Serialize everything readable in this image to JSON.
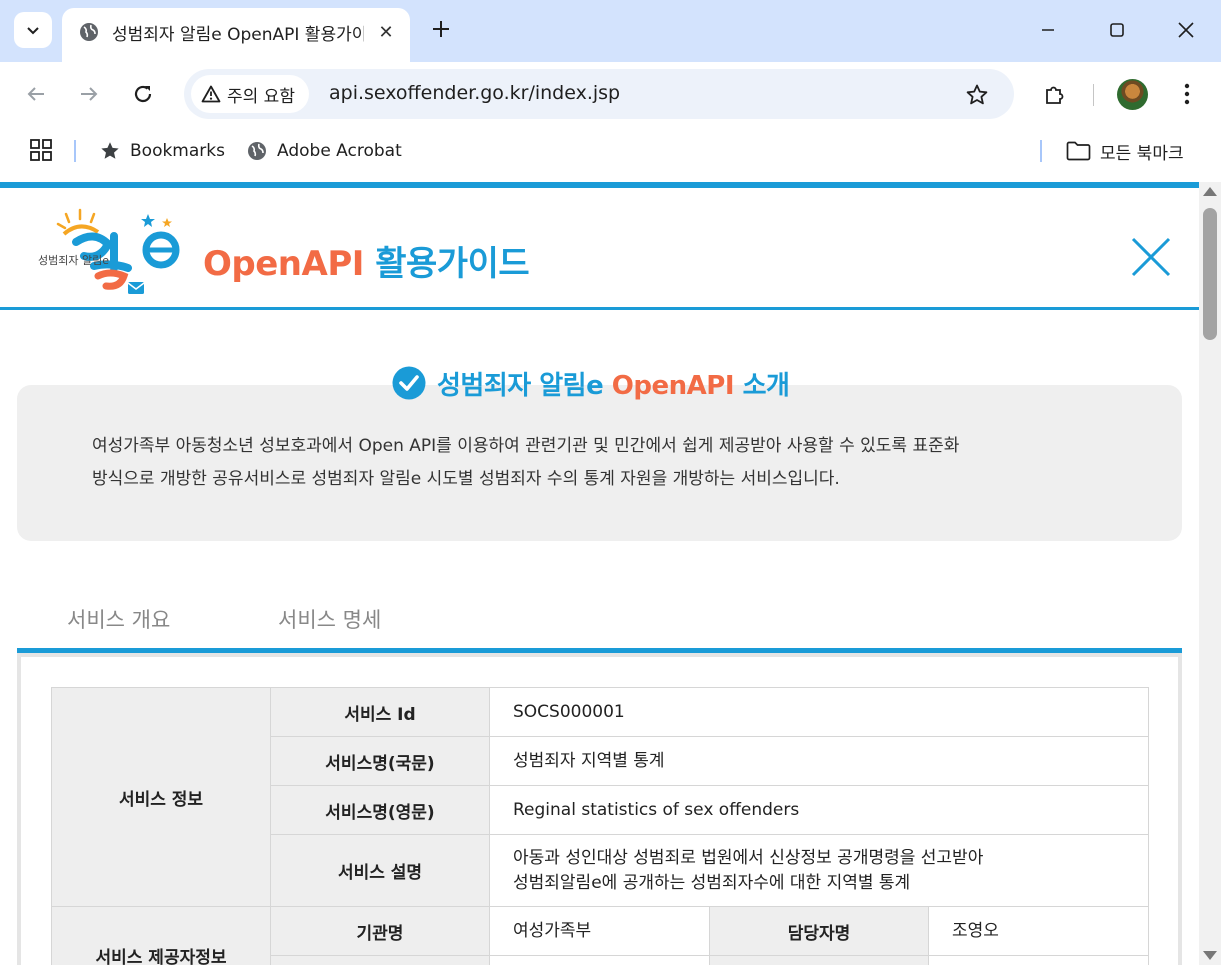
{
  "browser": {
    "tab_title": "성범죄자 알림e OpenAPI 활용가이드",
    "security_chip": "주의 요함",
    "url": "api.sexoffender.go.kr/index.jsp",
    "bookmarks": [
      {
        "label": "Bookmarks",
        "icon": "star-icon"
      },
      {
        "label": "Adobe Acrobat",
        "icon": "globe-icon"
      }
    ],
    "all_bookmarks": "모든 북마크"
  },
  "header": {
    "logo_text": "성범죄자 알림e",
    "title_open": "OpenAPI",
    "title_guide": "활용가이드"
  },
  "intro": {
    "title_main": "성범죄자 알림e",
    "title_api": "OpenAPI",
    "title_tail": "소개",
    "line1": "여성가족부 아동청소년 성보호과에서 Open API를 이용하여 관련기관 및 민간에서 쉽게 제공받아 사용할 수 있도록 표준화",
    "line2": "방식으로 개방한 공유서비스로 성범죄자 알림e 시도별 성범죄자 수의 통계 자원을 개방하는 서비스입니다."
  },
  "tabs": [
    {
      "label": "서비스 개요"
    },
    {
      "label": "서비스 명세"
    }
  ],
  "spec": {
    "group1": "서비스 정보",
    "service_id_label": "서비스 Id",
    "service_id": "SOCS000001",
    "name_kr_label": "서비스명(국문)",
    "name_kr": "성범죄자 지역별 통계",
    "name_en_label": "서비스명(영문)",
    "name_en": "Reginal statistics of sex offenders",
    "desc_label": "서비스 설명",
    "desc_line1": "아동과 성인대상 성범죄로 법원에서 신상정보 공개명령을 선고받아",
    "desc_line2": "성범죄알림e에 공개하는 성범죄자수에 대한 지역별 통계",
    "group2": "서비스 제공자정보",
    "org_label": "기관명",
    "org": "여성가족부",
    "manager_label": "담당자명",
    "manager": "조영오"
  },
  "colors": {
    "accent_blue": "#1a9bd7",
    "accent_orange": "#f26b45",
    "chrome_blue": "#d3e3fd"
  }
}
